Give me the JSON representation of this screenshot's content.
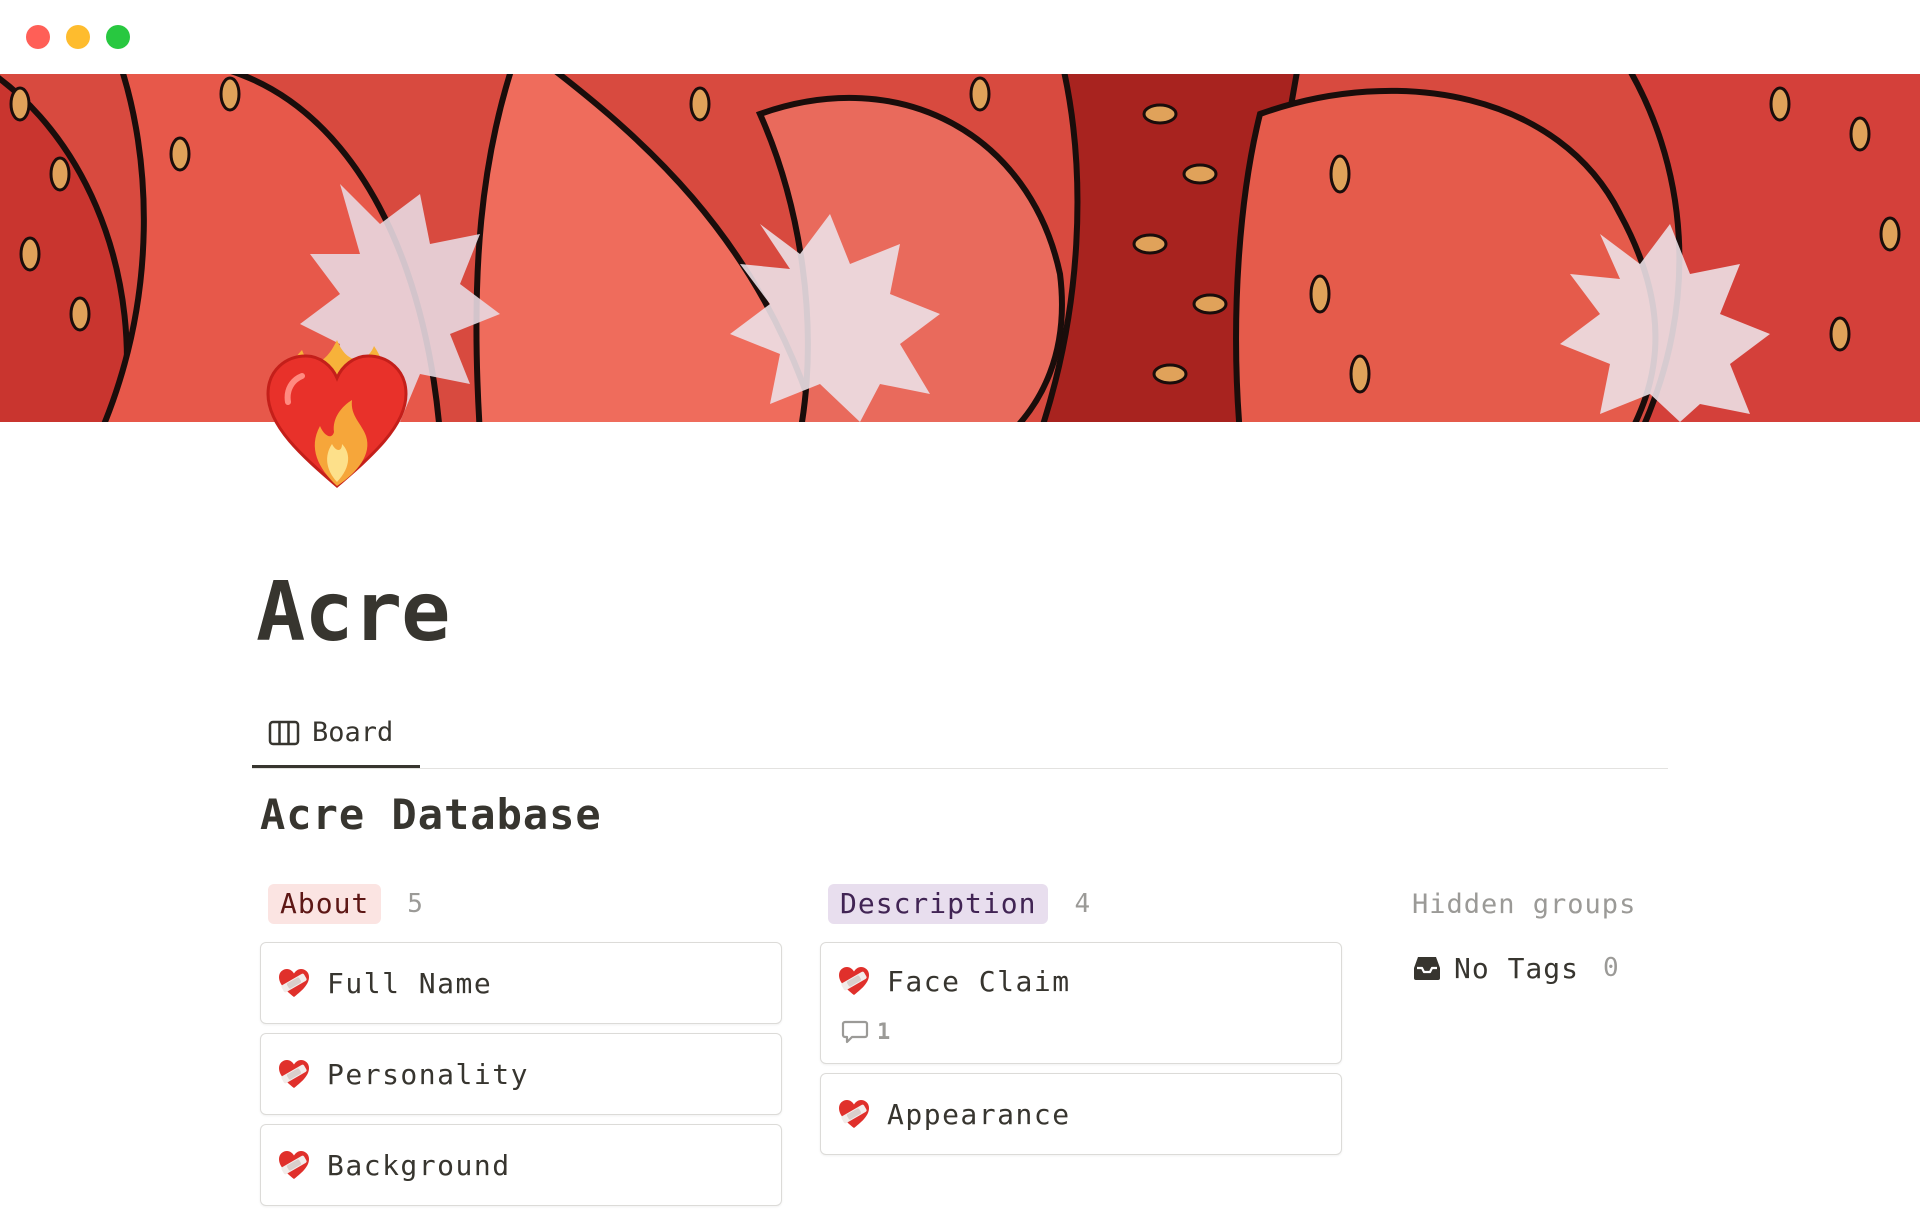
{
  "window": {
    "traffic_lights": {
      "close": "#ff5f57",
      "minimize": "#febc2e",
      "zoom": "#28c840"
    }
  },
  "cover": {
    "icon": "strawberry-illustration",
    "accent": "#d9403a"
  },
  "page": {
    "icon": "heart-on-fire-emoji",
    "title": "Acre"
  },
  "views": [
    {
      "label": "Board",
      "icon": "board-icon",
      "active": true
    }
  ],
  "database": {
    "title": "Acre Database",
    "groups": [
      {
        "label": "About",
        "count": "5",
        "color": "#fbe4e2",
        "cards": [
          {
            "title": "Full Name",
            "icon": "mending-heart-emoji"
          },
          {
            "title": "Personality",
            "icon": "mending-heart-emoji"
          },
          {
            "title": "Background",
            "icon": "mending-heart-emoji"
          }
        ]
      },
      {
        "label": "Description",
        "count": "4",
        "color": "#e8deee",
        "cards": [
          {
            "title": "Face Claim",
            "icon": "mending-heart-emoji",
            "comments": "1"
          },
          {
            "title": "Appearance",
            "icon": "mending-heart-emoji"
          }
        ]
      }
    ],
    "hidden_groups": {
      "title": "Hidden groups",
      "items": [
        {
          "label": "No Tags",
          "count": "0",
          "icon": "inbox-icon"
        }
      ]
    }
  }
}
